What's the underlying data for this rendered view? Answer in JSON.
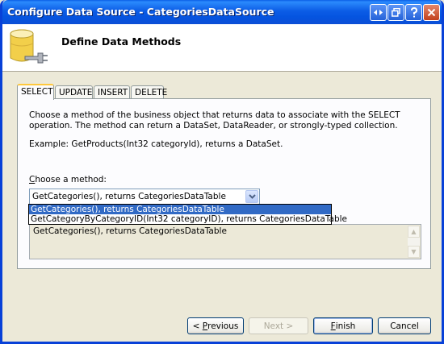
{
  "window": {
    "title": "Configure Data Source - CategoriesDataSource",
    "controls": [
      "help-icon",
      "restore-icon",
      "question-icon",
      "close-icon"
    ]
  },
  "header": {
    "heading": "Define Data Methods",
    "icon": "database-icon"
  },
  "tabs": [
    {
      "label": "SELECT",
      "active": true
    },
    {
      "label": "UPDATE",
      "active": false
    },
    {
      "label": "INSERT",
      "active": false
    },
    {
      "label": "DELETE",
      "active": false
    }
  ],
  "select_tab": {
    "description": "Choose a method of the business object that returns data to associate with the SELECT operation. The method can return a DataSet, DataReader, or strongly-typed collection.",
    "example": "Example: GetProducts(Int32 categoryId), returns a DataSet.",
    "method_label_mnemonic": "C",
    "method_label_rest": "hoose a method:",
    "selected_method": "GetCategories(), returns CategoriesDataTable",
    "options": [
      "GetCategories(), returns CategoriesDataTable",
      "GetCategoryByCategoryID(Int32 categoryID), returns CategoriesDataTable"
    ],
    "method_signature": "GetCategories(), returns CategoriesDataTable"
  },
  "buttons": {
    "previous_mnemonic": "P",
    "previous_prefix": "< ",
    "previous_rest": "revious",
    "next_label": "Next >",
    "finish_mnemonic": "F",
    "finish_rest": "inish",
    "cancel_label": "Cancel"
  },
  "colors": {
    "titlebar": "#0554e0",
    "selection": "#316ac5",
    "tab_highlight": "#ffc83c"
  }
}
